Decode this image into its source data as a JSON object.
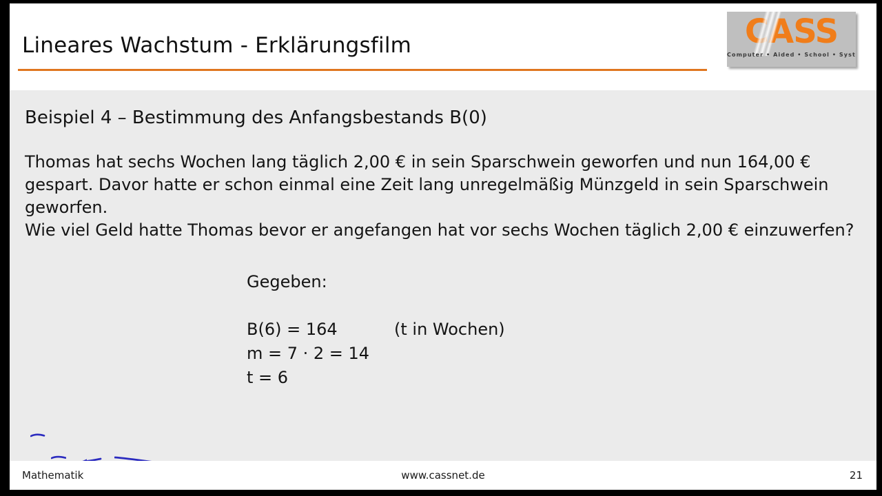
{
  "header": {
    "title": "Lineares Wachstum - Erklärungsfilm",
    "rule_color": "#E0761F"
  },
  "logo": {
    "wordmark": "CASS",
    "tagline": "Computer • Aided • School • System",
    "word_color": "#F07D1A",
    "background_color": "#BFBFBF"
  },
  "content": {
    "example_heading": "Beispiel 4 – Bestimmung des Anfangsbestands B(0)",
    "problem_paragraphs": [
      "Thomas hat sechs Wochen lang täglich 2,00 € in sein Sparschwein geworfen und nun 164,00 € gespart. Davor hatte er schon einmal eine Zeit lang unregelmäßig Münzgeld in sein Sparschwein geworfen.",
      "Wie viel Geld hatte Thomas bevor er angefangen hat vor sechs Wochen täglich 2,00 € einzuwerfen?"
    ],
    "given_label": "Gegeben:",
    "equations": [
      {
        "expression": "B(6) = 164",
        "note": "(t in Wochen)"
      },
      {
        "expression": "m = 7 · 2 = 14",
        "note": ""
      },
      {
        "expression": "t = 6",
        "note": ""
      }
    ],
    "annotation_color": "#2B2BBF",
    "background_color": "#EBEBEB"
  },
  "footer": {
    "subject": "Mathematik",
    "url": "www.cassnet.de",
    "page_number": "21"
  }
}
